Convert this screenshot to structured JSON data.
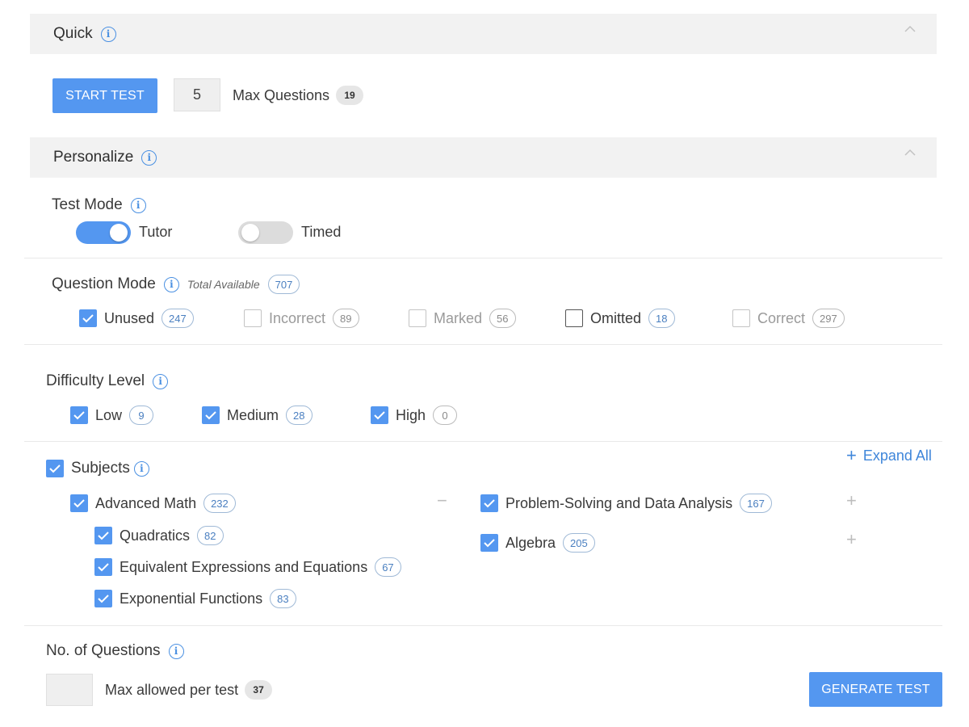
{
  "quick": {
    "title": "Quick",
    "start_label": "START TEST",
    "count_value": "5",
    "max_label": "Max Questions",
    "max_count": "19"
  },
  "personalize": {
    "title": "Personalize"
  },
  "test_mode": {
    "heading": "Test Mode",
    "tutor_label": "Tutor",
    "tutor_on": true,
    "timed_label": "Timed",
    "timed_on": false
  },
  "question_mode": {
    "heading": "Question Mode",
    "total_label": "Total Available",
    "total_count": "707",
    "options": [
      {
        "label": "Unused",
        "count": "247",
        "checked": true
      },
      {
        "label": "Incorrect",
        "count": "89",
        "checked": false
      },
      {
        "label": "Marked",
        "count": "56",
        "checked": false
      },
      {
        "label": "Omitted",
        "count": "18",
        "checked": false
      },
      {
        "label": "Correct",
        "count": "297",
        "checked": false
      }
    ]
  },
  "difficulty": {
    "heading": "Difficulty Level",
    "options": [
      {
        "label": "Low",
        "count": "9",
        "checked": true
      },
      {
        "label": "Medium",
        "count": "28",
        "checked": true
      },
      {
        "label": "High",
        "count": "0",
        "checked": true
      }
    ]
  },
  "subjects": {
    "heading": "Subjects",
    "expand_all": "Expand All",
    "left": {
      "label": "Advanced Math",
      "count": "232",
      "children": [
        {
          "label": "Quadratics",
          "count": "82"
        },
        {
          "label": "Equivalent Expressions and Equations",
          "count": "67"
        },
        {
          "label": "Exponential Functions",
          "count": "83"
        }
      ]
    },
    "right": [
      {
        "label": "Problem-Solving and Data Analysis",
        "count": "167"
      },
      {
        "label": "Algebra",
        "count": "205"
      }
    ]
  },
  "num_questions": {
    "heading": "No. of Questions",
    "max_label": "Max allowed per test",
    "max_count": "37",
    "generate_label": "GENERATE TEST"
  },
  "colors": {
    "accent": "#5497f0",
    "link": "#3f86da",
    "section_bg": "#f2f2f2"
  }
}
